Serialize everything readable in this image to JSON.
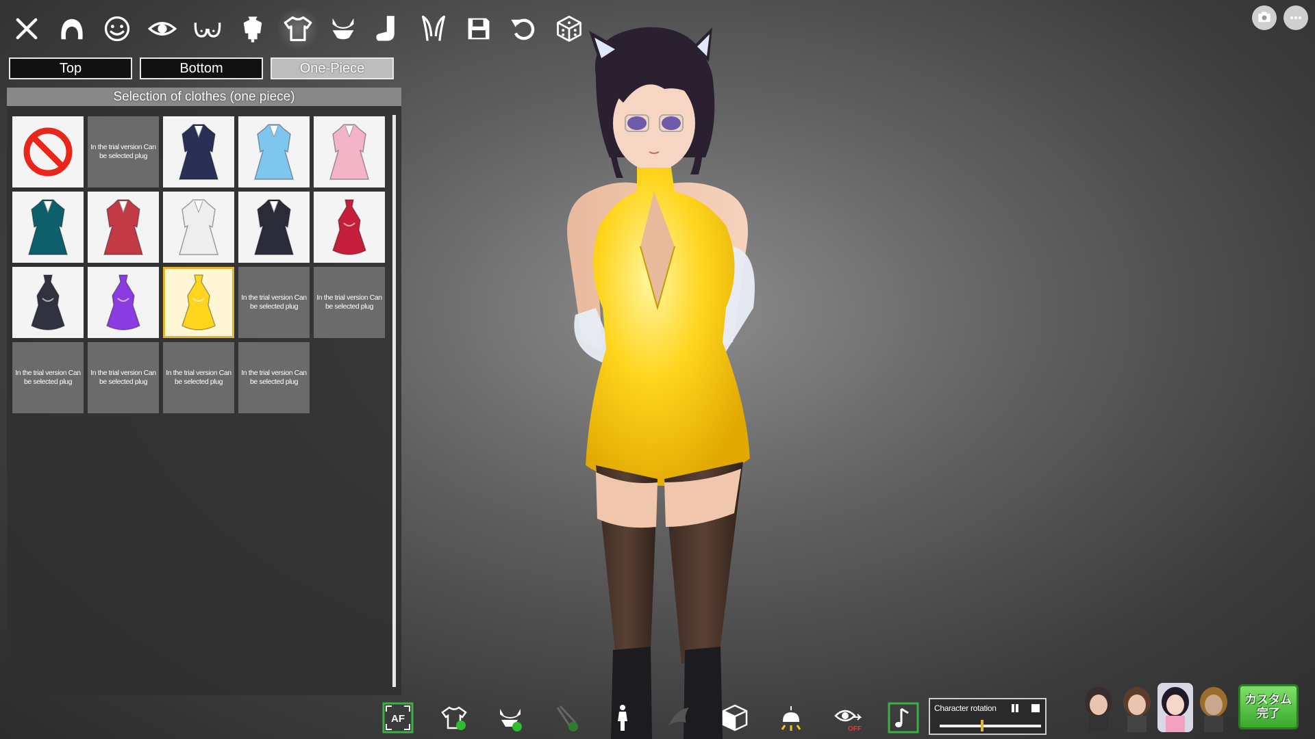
{
  "toolbar": {
    "icons": [
      "close-icon",
      "hair-icon",
      "face-icon",
      "eye-icon",
      "chest-icon",
      "body-icon",
      "clothes-icon",
      "underwear-icon",
      "sock-icon",
      "accessory-icon",
      "save-icon",
      "undo-icon",
      "random-dice-icon"
    ],
    "active": "clothes-icon"
  },
  "top_right": [
    "screenshot-icon",
    "more-icon"
  ],
  "tabs": {
    "top": "Top",
    "bottom": "Bottom",
    "one_piece": "One-Piece",
    "active": "One-Piece"
  },
  "panel": {
    "title": "Selection of clothes (one piece)",
    "locked_text": "In the trial version Can be selected plug",
    "items": [
      {
        "kind": "none"
      },
      {
        "kind": "locked"
      },
      {
        "kind": "dress",
        "color": "#2a2f55"
      },
      {
        "kind": "dress",
        "color": "#7ec6ee"
      },
      {
        "kind": "dress",
        "color": "#f4b4c8"
      },
      {
        "kind": "dress",
        "color": "#0e5f6c"
      },
      {
        "kind": "dress",
        "color": "#c23a46"
      },
      {
        "kind": "dress",
        "color": "#eeeeee"
      },
      {
        "kind": "dress",
        "color": "#2a2c3a"
      },
      {
        "kind": "halter",
        "color": "#c41e3a"
      },
      {
        "kind": "halter",
        "color": "#30323f"
      },
      {
        "kind": "halter",
        "color": "#8b3ce0"
      },
      {
        "kind": "halter",
        "color": "#ffd51e",
        "selected": true
      },
      {
        "kind": "locked"
      },
      {
        "kind": "locked"
      },
      {
        "kind": "locked"
      },
      {
        "kind": "locked"
      },
      {
        "kind": "locked"
      },
      {
        "kind": "locked"
      }
    ]
  },
  "bottom_bar": {
    "icons": [
      "autofocus-icon",
      "outfit-toggle-icon",
      "underwear-toggle-icon",
      "accessory-toggle-icon",
      "pose-icon",
      "wind-icon",
      "room-icon",
      "light-icon",
      "eye-tracking-icon",
      "music-icon"
    ],
    "autofocus_label": "AF",
    "eye_tracking_state": "OFF"
  },
  "rotation": {
    "label": "Character rotation",
    "value": 0.42
  },
  "presets": [
    "preset-character-1",
    "preset-character-2",
    "preset-character-3",
    "preset-character-4"
  ],
  "done_button": {
    "label": "カスタム\n完了"
  },
  "colors": {
    "accent": "#e8b330",
    "done_green": "#39a82c",
    "dress_yellow": "#ffd51e"
  }
}
